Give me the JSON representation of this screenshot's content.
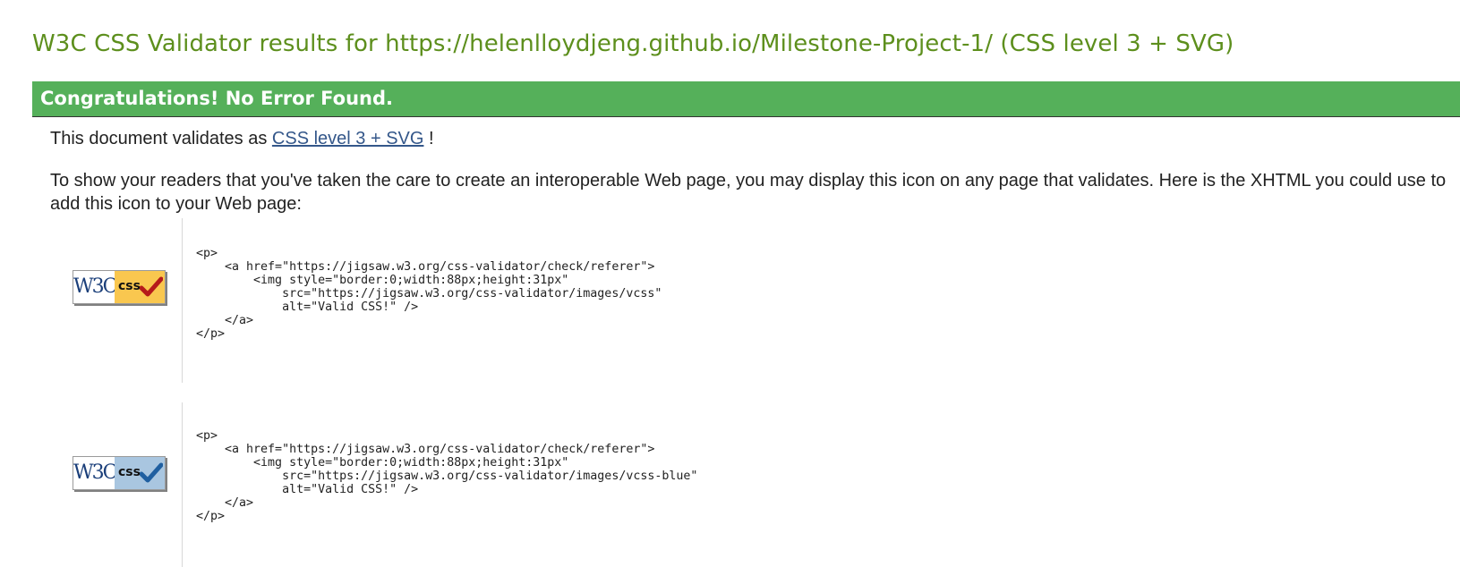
{
  "page": {
    "title": "W3C CSS Validator results for https://helenlloydjeng.github.io/Milestone-Project-1/ (CSS level 3 + SVG)"
  },
  "banner": {
    "text": "Congratulations! No Error Found.",
    "color": "#55b05a"
  },
  "validation": {
    "prefix": "This document validates as",
    "link_text": "CSS level 3 + SVG",
    "suffix": "!"
  },
  "info": {
    "paragraph": "To show your readers that you've taken the care to create an interoperable Web page, you may display this icon on any page that validates. Here is the XHTML you could use to add this icon to your Web page:"
  },
  "badges": [
    {
      "w3c_text": "W3C",
      "css_text": "css",
      "icon": "w3c-css-badge-gold",
      "panel_color": "#f9c74f",
      "check_color": "#b51a1a",
      "code": "<p>\n    <a href=\"https://jigsaw.w3.org/css-validator/check/referer\">\n        <img style=\"border:0;width:88px;height:31px\"\n            src=\"https://jigsaw.w3.org/css-validator/images/vcss\"\n            alt=\"Valid CSS!\" />\n    </a>\n</p>"
    },
    {
      "w3c_text": "W3C",
      "css_text": "css",
      "icon": "w3c-css-badge-blue",
      "panel_color": "#a9c6e0",
      "check_color": "#1f5fa0",
      "code": "<p>\n    <a href=\"https://jigsaw.w3.org/css-validator/check/referer\">\n        <img style=\"border:0;width:88px;height:31px\"\n            src=\"https://jigsaw.w3.org/css-validator/images/vcss-blue\"\n            alt=\"Valid CSS!\" />\n    </a>\n</p>"
    }
  ]
}
